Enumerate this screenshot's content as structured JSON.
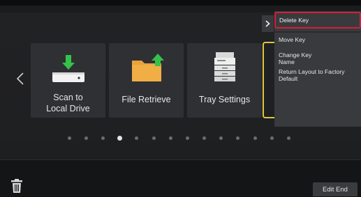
{
  "tiles": [
    {
      "label": "Scan to\nLocal Drive",
      "icon": "scanner-download-icon"
    },
    {
      "label": "File Retrieve",
      "icon": "folder-upload-icon"
    },
    {
      "label": "Tray Settings",
      "icon": "printer-tray-icon"
    }
  ],
  "pagination": {
    "count": 14,
    "active_index": 3
  },
  "context_menu": {
    "items": [
      {
        "label": "Delete Key"
      },
      {
        "label": "Move Key"
      },
      {
        "label": "Change Key\nName"
      },
      {
        "label": "Return Layout to Factory\nDefault"
      }
    ]
  },
  "footer": {
    "edit_end_label": "Edit End"
  },
  "colors": {
    "selection": "#e3c53a",
    "highlight_border": "#d0203a",
    "accent_green": "#36c24a",
    "folder": "#e8a33c"
  }
}
